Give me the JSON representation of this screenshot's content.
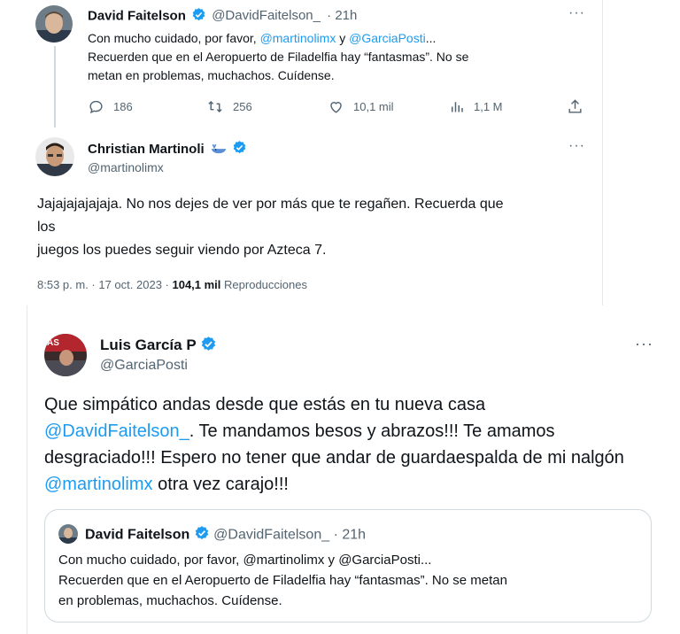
{
  "thread": {
    "tweet1": {
      "display_name": "David Faitelson",
      "handle": "@DavidFaitelson_",
      "time": "· 21h",
      "text_prefix": "Con mucho cuidado, por favor, ",
      "mention1": "@martinolimx",
      "text_mid": " y ",
      "mention2": "@GarciaPosti",
      "text_suffix": "...",
      "line2": "Recuerden que en el Aeropuerto de Filadelfia hay “fantasmas”. No se",
      "line3": "metan en problemas, muchachos. Cuídense.",
      "replies": "186",
      "retweets": "256",
      "likes": "10,1 mil",
      "views": "1,1 M",
      "more": "···"
    },
    "tweet2": {
      "display_name": "Christian Martinoli",
      "handle": "@martinolimx",
      "line1": "Jajajajajajaja. No nos dejes de ver por más que te regañen. Recuerda que",
      "line2": "los",
      "line3": "juegos los puedes seguir viendo por Azteca 7.",
      "timestamp": "8:53 p. m. · 17 oct. 2023 · ",
      "view_count": "104,1 mil",
      "views_label": " Reproducciones",
      "more": "···"
    }
  },
  "reply": {
    "display_name": "Luis García P",
    "handle": "@GarciaPosti",
    "line1": "Que simpático andas desde que estás en tu nueva casa",
    "line2_mention": "@DavidFaitelson_",
    "line2_text": ". Te mandamos besos y abrazos!!! Te amamos",
    "line3": "desgraciado!!! Espero no tener que andar de guardaespalda de mi nalgón",
    "line4_mention": "@martinolimx",
    "line4_text": " otra vez carajo!!!",
    "more": "···",
    "avatar_text": "AS",
    "quote": {
      "display_name": "David Faitelson",
      "handle": "@DavidFaitelson_",
      "time": "· 21h",
      "line1": "Con mucho cuidado, por favor, @martinolimx y @GarciaPosti...",
      "line2": "Recuerden que en el Aeropuerto de Filadelfia hay “fantasmas”. No se metan",
      "line3": "en problemas, muchachos. Cuídense."
    }
  },
  "colors": {
    "link": "#1d9bf0",
    "verified": "#1d9bf0",
    "muted": "#536471",
    "text": "#0f1419"
  },
  "icons": [
    "verified-badge-icon",
    "reply-icon",
    "retweet-icon",
    "like-icon",
    "views-icon",
    "share-icon",
    "more-icon",
    "whale-emoji-icon"
  ]
}
